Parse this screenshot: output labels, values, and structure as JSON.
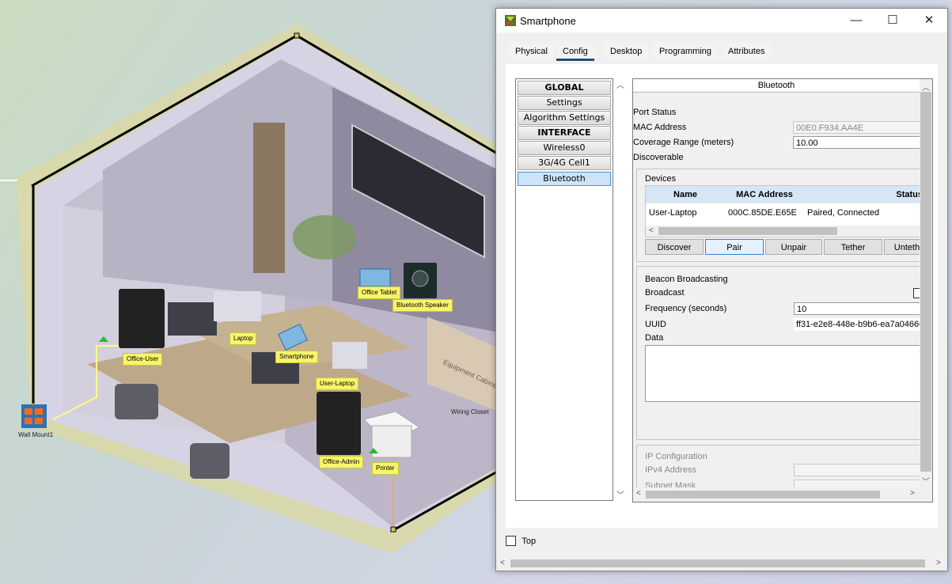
{
  "workspace": {
    "devices": [
      {
        "label": "Office-User"
      },
      {
        "label": "Laptop"
      },
      {
        "label": "Smartphone"
      },
      {
        "label": "Office Tablet"
      },
      {
        "label": "Bluetooth Speaker"
      },
      {
        "label": "User-Laptop"
      },
      {
        "label": "Office-Admin"
      },
      {
        "label": "Printer"
      }
    ],
    "wall_mount_label": "Wall Mount1",
    "wiring_closet_label": "Wiring Closet",
    "cabinet_label": "Equipment Cabinet"
  },
  "window": {
    "title": "Smartphone",
    "controls": {
      "minimize": "—",
      "maximize": "☐",
      "close": "✕"
    },
    "tabs": [
      "Physical",
      "Config",
      "Desktop",
      "Programming",
      "Attributes"
    ],
    "active_tab": "Config",
    "menu": [
      {
        "label": "GLOBAL",
        "header": true
      },
      {
        "label": "Settings"
      },
      {
        "label": "Algorithm Settings"
      },
      {
        "label": "INTERFACE",
        "header": true
      },
      {
        "label": "Wireless0"
      },
      {
        "label": "3G/4G Cell1"
      },
      {
        "label": "Bluetooth",
        "selected": true
      }
    ],
    "panel": {
      "heading": "Bluetooth",
      "port_status_label": "Port Status",
      "mac_label": "MAC Address",
      "mac_value": "00E0.F934.AA4E",
      "coverage_label": "Coverage Range (meters)",
      "coverage_value": "10.00",
      "discoverable_label": "Discoverable",
      "devices": {
        "title": "Devices",
        "columns": [
          "Name",
          "MAC Address",
          "Status"
        ],
        "rows": [
          {
            "name": "User-Laptop",
            "mac": "000C.85DE.E65E",
            "status": "Paired, Connected"
          }
        ],
        "buttons": [
          "Discover",
          "Pair",
          "Unpair",
          "Tether",
          "Unteth"
        ]
      },
      "beacon": {
        "title": "Beacon Broadcasting",
        "broadcast_label": "Broadcast",
        "frequency_label": "Frequency (seconds)",
        "frequency_value": "10",
        "uuid_label": "UUID",
        "uuid_value": "ff31-e2e8-448e-b9b6-ea7a04660",
        "data_label": "Data"
      },
      "ip": {
        "title": "IP Configuration",
        "ipv4_label": "IPv4 Address",
        "subnet_label": "Subnet Mask"
      }
    },
    "top_checkbox_label": "Top"
  },
  "colors": {
    "label_bg": "#f7f56a",
    "active_tab_underline": "#1e4d7b",
    "selected_menu": "#cde4f7",
    "room_wall_outline": "#000000"
  }
}
